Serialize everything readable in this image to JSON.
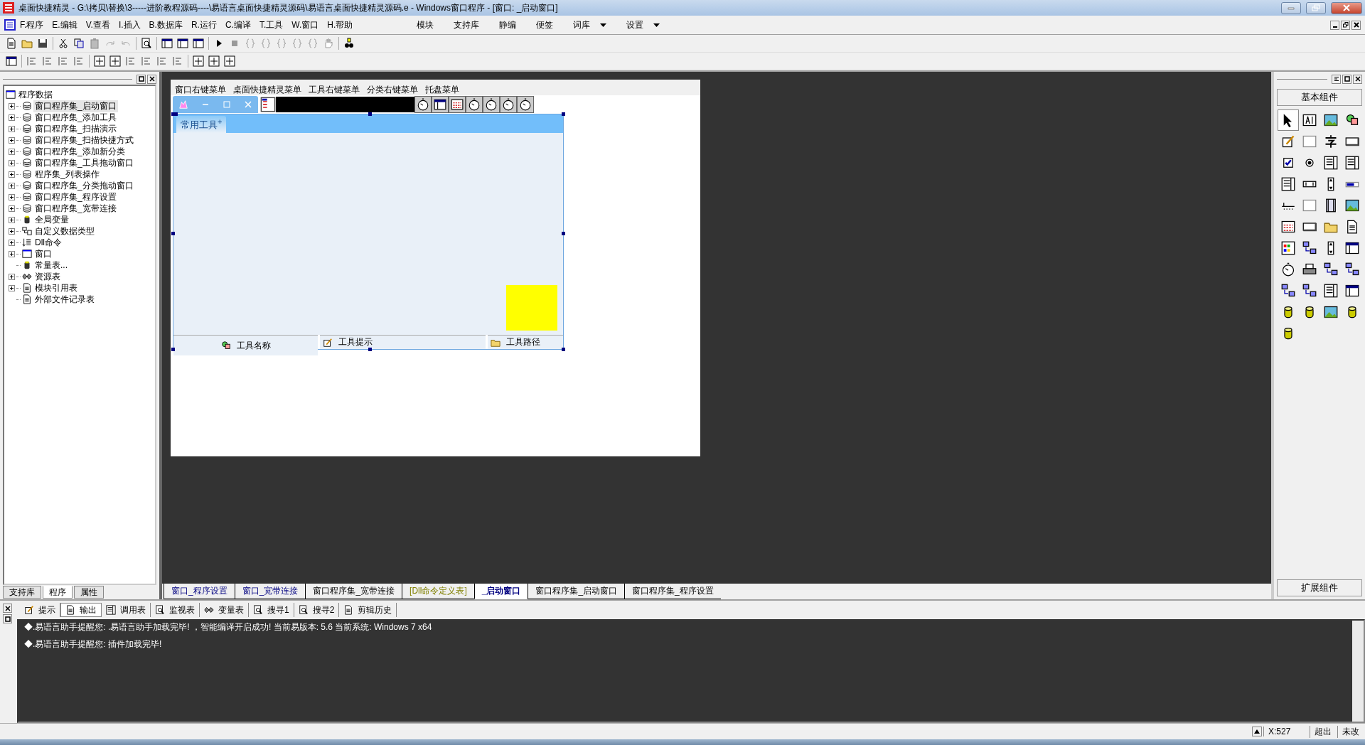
{
  "window": {
    "title": "桌面快捷精灵 - G:\\拷贝\\替换\\3-----进阶教程源码----\\易语言桌面快捷精灵源码\\易语言桌面快捷精灵源码.e - Windows窗口程序 - [窗口: _启动窗口]"
  },
  "menu": [
    {
      "label": "F.程序"
    },
    {
      "label": "E.编辑"
    },
    {
      "label": "V.查看"
    },
    {
      "label": "I.插入"
    },
    {
      "label": "B.数据库"
    },
    {
      "label": "R.运行"
    },
    {
      "label": "C.编译"
    },
    {
      "label": "T.工具"
    },
    {
      "label": "W.窗口"
    },
    {
      "label": "H.帮助"
    }
  ],
  "menu_right": [
    {
      "label": "模块",
      "dropdown": false
    },
    {
      "label": "支持库",
      "dropdown": false
    },
    {
      "label": "静编",
      "dropdown": false
    },
    {
      "label": "便签",
      "dropdown": false
    },
    {
      "label": "词库",
      "dropdown": true
    },
    {
      "label": "设置",
      "dropdown": true
    }
  ],
  "tree": {
    "label": "程序数据",
    "children": [
      {
        "label": "窗口程序集_启动窗口",
        "kind": "program_set",
        "expandable": true,
        "selected": true
      },
      {
        "label": "窗口程序集_添加工具",
        "kind": "program_set",
        "expandable": true,
        "selected": false
      },
      {
        "label": "窗口程序集_扫描演示",
        "kind": "program_set",
        "expandable": true,
        "selected": false
      },
      {
        "label": "窗口程序集_扫描快捷方式",
        "kind": "program_set",
        "expandable": true,
        "selected": false
      },
      {
        "label": "窗口程序集_添加新分类",
        "kind": "program_set",
        "expandable": true,
        "selected": false
      },
      {
        "label": "窗口程序集_工具拖动窗口",
        "kind": "program_set",
        "expandable": true,
        "selected": false
      },
      {
        "label": "程序集_列表操作",
        "kind": "program_set",
        "expandable": true,
        "selected": false
      },
      {
        "label": "窗口程序集_分类拖动窗口",
        "kind": "program_set",
        "expandable": true,
        "selected": false
      },
      {
        "label": "窗口程序集_程序设置",
        "kind": "program_set",
        "expandable": true,
        "selected": false
      },
      {
        "label": "窗口程序集_宽带连接",
        "kind": "program_set",
        "expandable": true,
        "selected": false
      },
      {
        "label": "全局变量",
        "kind": "variable",
        "expandable": true,
        "selected": false
      },
      {
        "label": "自定义数据类型",
        "kind": "datatype",
        "expandable": true,
        "selected": false
      },
      {
        "label": "Dll命令",
        "kind": "dll",
        "expandable": true,
        "selected": false
      },
      {
        "label": "窗口",
        "kind": "window",
        "expandable": true,
        "selected": false
      },
      {
        "label": "常量表...",
        "kind": "constants",
        "expandable": false,
        "selected": false
      },
      {
        "label": "资源表",
        "kind": "resources",
        "expandable": true,
        "selected": false
      },
      {
        "label": "模块引用表",
        "kind": "modules",
        "expandable": true,
        "selected": false
      },
      {
        "label": "外部文件记录表",
        "kind": "files",
        "expandable": false,
        "selected": false
      }
    ]
  },
  "left_tabs": [
    {
      "label": "支持库",
      "selected": false
    },
    {
      "label": "程序",
      "selected": true
    },
    {
      "label": "属性",
      "selected": false
    }
  ],
  "designer": {
    "menus": [
      {
        "label": "窗口右键菜单"
      },
      {
        "label": "桌面快捷精灵菜单"
      },
      {
        "label": "工具右键菜单"
      },
      {
        "label": "分类右键菜单"
      },
      {
        "label": "托盘菜单"
      }
    ],
    "tab": {
      "label": "常用工具",
      "mark": "+"
    },
    "status_panels": [
      {
        "label": "工具名称",
        "kind": "tool"
      },
      {
        "label": "工具提示",
        "kind": "note"
      },
      {
        "label": "工具路径",
        "kind": "folder"
      }
    ]
  },
  "editor_tabs": [
    {
      "label": "窗口_程序设置",
      "kind": "window",
      "selected": false
    },
    {
      "label": "窗口_宽带连接",
      "kind": "window",
      "selected": false
    },
    {
      "label": "窗口程序集_宽带连接",
      "kind": "code",
      "selected": false
    },
    {
      "label": "[Dll命令定义表]",
      "kind": "dll",
      "selected": false
    },
    {
      "label": "_启动窗口",
      "kind": "window",
      "selected": true
    },
    {
      "label": "窗口程序集_启动窗口",
      "kind": "code",
      "selected": false
    },
    {
      "label": "窗口程序集_程序设置",
      "kind": "code",
      "selected": false
    }
  ],
  "toolbox": {
    "header": "基本组件",
    "footer": "扩展组件"
  },
  "output_tabs": [
    {
      "label": "提示",
      "kind": "hint",
      "selected": false
    },
    {
      "label": "输出",
      "kind": "output",
      "selected": true
    },
    {
      "label": "调用表",
      "kind": "calls",
      "selected": false
    },
    {
      "label": "监视表",
      "kind": "watch",
      "selected": false
    },
    {
      "label": "变量表",
      "kind": "vars",
      "selected": false
    },
    {
      "label": "搜寻1",
      "kind": "search",
      "selected": false
    },
    {
      "label": "搜寻2",
      "kind": "search",
      "selected": false
    },
    {
      "label": "剪辑历史",
      "kind": "clip",
      "selected": false
    }
  ],
  "output_lines": [
    "◆.易语言助手提醒您: .易语言助手加载完毕! ，智能编译开启成功! 当前易版本: 5.6 当前系统: Windows 7 x64",
    "◆.易语言助手提醒您: 插件加载完毕!"
  ],
  "status_bar": {
    "position": "X:527",
    "mode": "超出",
    "state": "未改"
  }
}
